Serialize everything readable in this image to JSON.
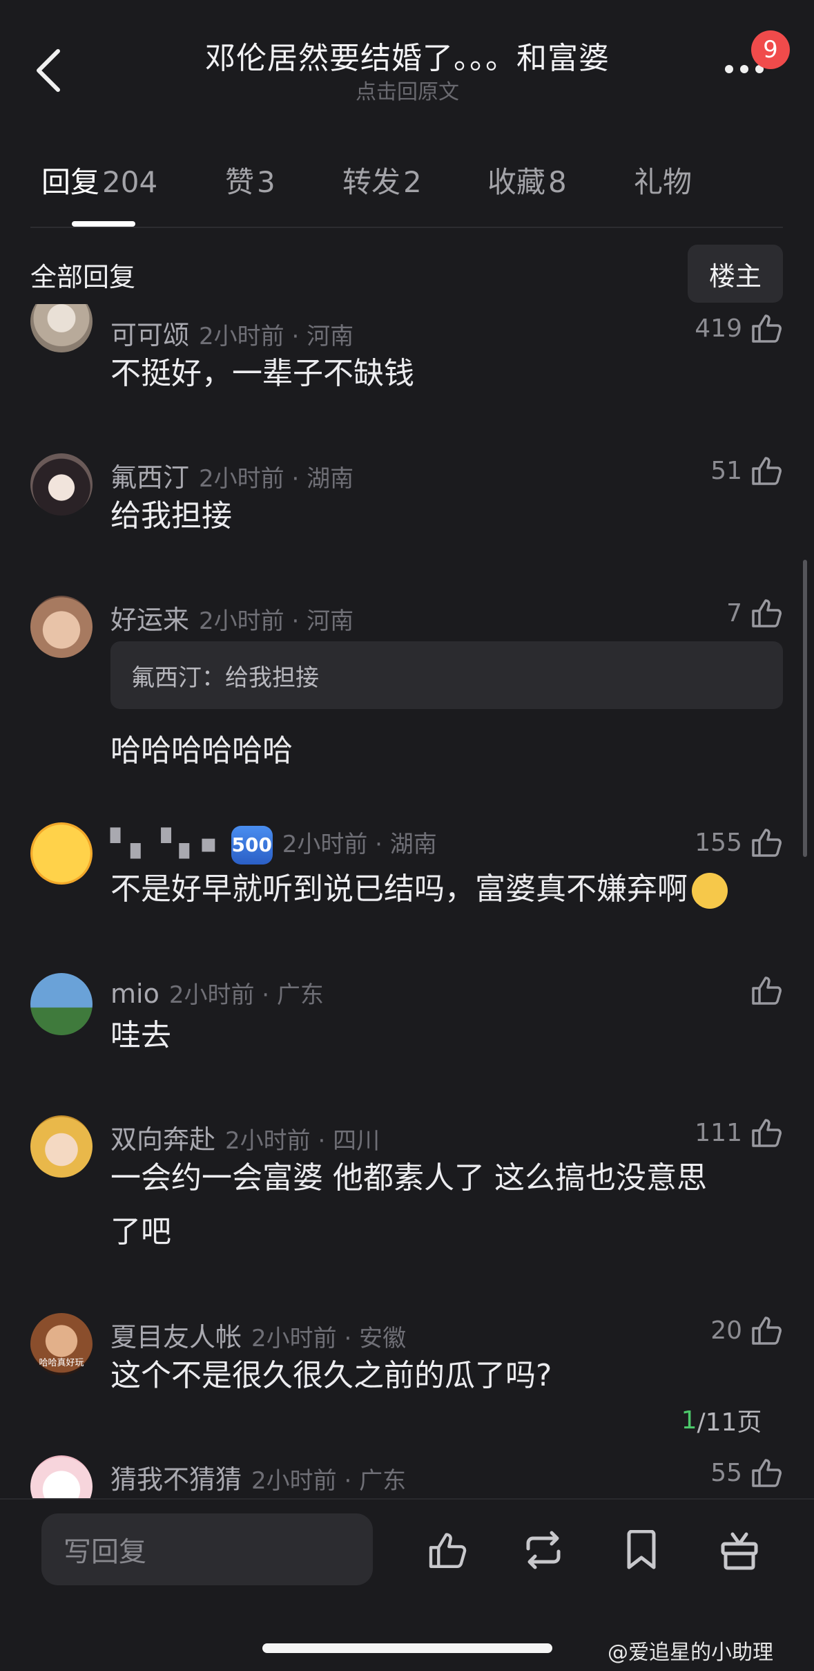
{
  "header": {
    "title": "邓伦居然要结婚了。。。和富婆",
    "subtitle": "点击回原文",
    "notification_count": "9"
  },
  "tabs": [
    {
      "label": "回复",
      "count": "204",
      "active": true
    },
    {
      "label": "赞",
      "count": "3"
    },
    {
      "label": "转发",
      "count": "2"
    },
    {
      "label": "收藏",
      "count": "8"
    },
    {
      "label": "礼物",
      "count": ""
    }
  ],
  "section": {
    "title": "全部回复",
    "owner_button": "楼主"
  },
  "comments": [
    {
      "name": "可可颂",
      "time": "2小时前 · 河南",
      "likes": "419",
      "text": "不挺好，一辈子不缺钱"
    },
    {
      "name": "氟西汀",
      "time": "2小时前 · 湖南",
      "likes": "51",
      "text": "给我担接"
    },
    {
      "name": "好运来",
      "time": "2小时前 · 河南",
      "likes": "7",
      "quote": "氟西汀：给我担接",
      "text": "哈哈哈哈哈哈"
    },
    {
      "name": "▘▖▝ ▖▪",
      "badge": "500",
      "time": "2小时前 · 湖南",
      "likes": "155",
      "text": "不是好早就听到说已结吗，富婆真不嫌弃啊"
    },
    {
      "name": "mio",
      "time": "2小时前 · 广东",
      "likes": "",
      "text": "哇去"
    },
    {
      "name": "双向奔赴",
      "time": "2小时前 · 四川",
      "likes": "111",
      "text_line1": "一会约一会富婆 他都素人了 这么搞也没意思",
      "text_line2": "了吧"
    },
    {
      "name": "夏目友人帐",
      "time": "2小时前 · 安徽",
      "likes": "20",
      "text": "这个不是很久很久之前的瓜了吗?",
      "avatar_caption": "哈哈真好玩"
    },
    {
      "name": "猜我不猜猜",
      "time": "2小时前 · 广东",
      "likes": "55",
      "text": ""
    }
  ],
  "pager": {
    "current": "1",
    "total": "/11页"
  },
  "bottom": {
    "reply_placeholder": "写回复"
  },
  "watermark": "@爱追星的小助理",
  "colors": {
    "background": "#1b1b1e",
    "badge": "#f04b4b",
    "pager_current": "#4cc86a"
  }
}
